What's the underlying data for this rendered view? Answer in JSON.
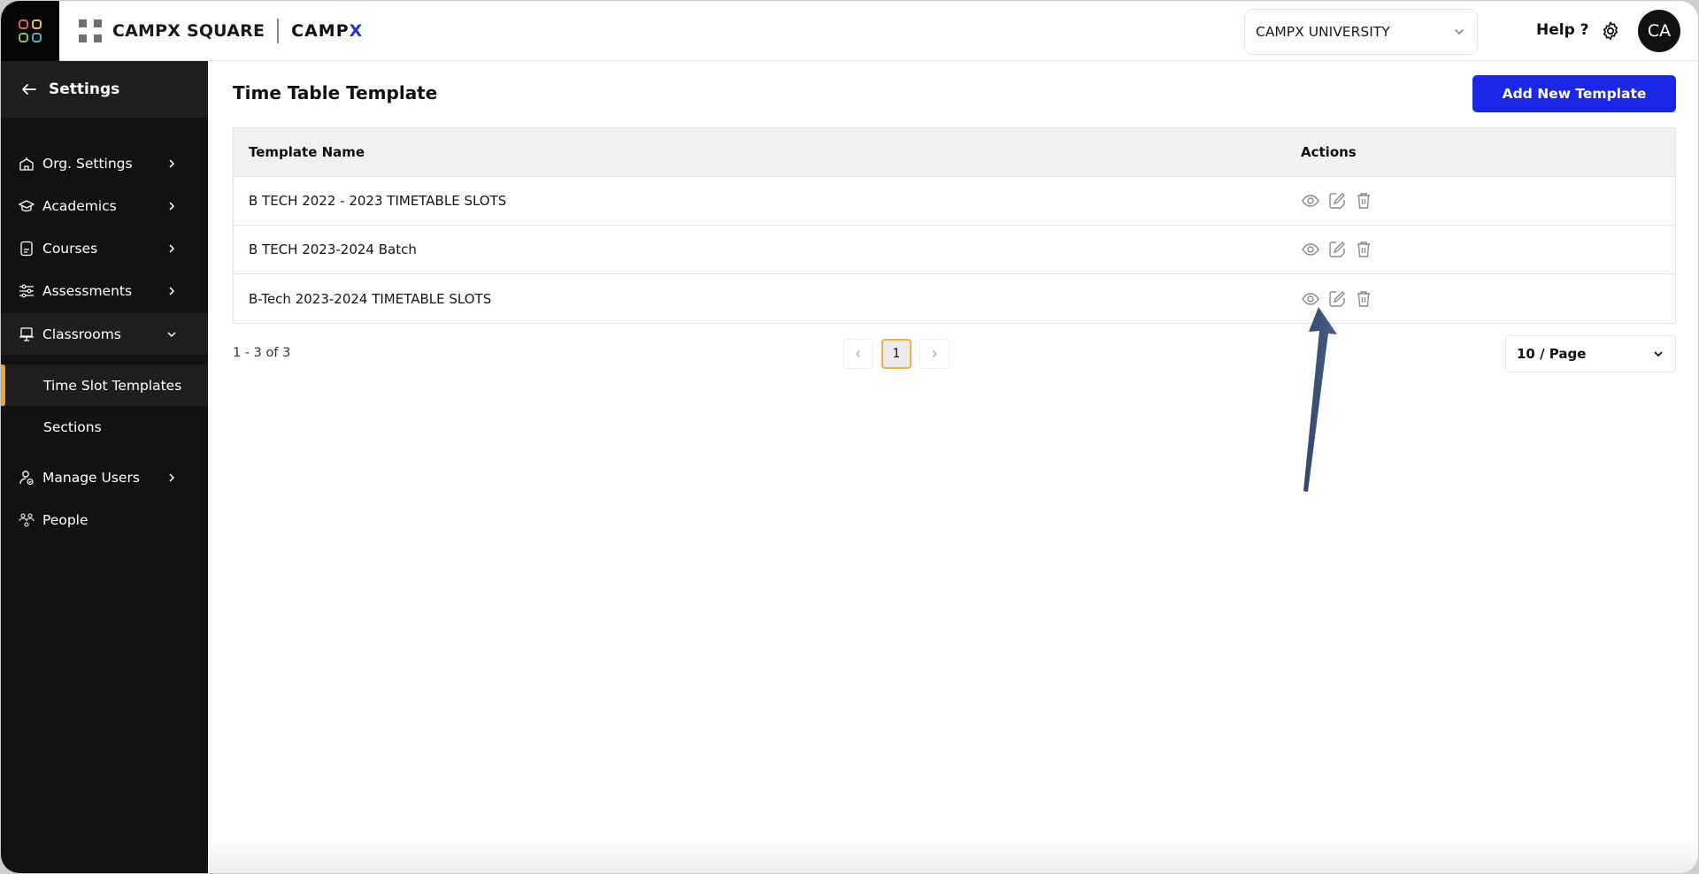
{
  "header": {
    "apps_icon": "apps-grid-icon",
    "apps_colors": [
      "#d9645c",
      "#e3c45a",
      "#8fbf6a",
      "#5fa9cf"
    ],
    "brand_primary": "CAMPX SQUARE",
    "brand_secondary_main": "CAMP",
    "brand_secondary_accent": "X",
    "brand_accent_color": "#2236c9",
    "org_select": {
      "value": "CAMPX UNIVERSITY"
    },
    "help_label": "Help ?",
    "settings_icon": "gear-icon",
    "avatar_initials": "CA"
  },
  "sidebar": {
    "title": "Settings",
    "items": [
      {
        "label": "Org. Settings",
        "icon": "building-icon",
        "expandable": true,
        "expanded": false
      },
      {
        "label": "Academics",
        "icon": "graduation-cap-icon",
        "expandable": true,
        "expanded": false
      },
      {
        "label": "Courses",
        "icon": "document-icon",
        "expandable": true,
        "expanded": false
      },
      {
        "label": "Assessments",
        "icon": "sliders-icon",
        "expandable": true,
        "expanded": false
      },
      {
        "label": "Classrooms",
        "icon": "monitor-icon",
        "expandable": true,
        "expanded": true,
        "children": [
          {
            "label": "Time Slot Templates",
            "active": true
          },
          {
            "label": "Sections",
            "active": false
          }
        ]
      },
      {
        "label": "Manage Users",
        "icon": "user-check-icon",
        "expandable": true,
        "expanded": false
      },
      {
        "label": "People",
        "icon": "people-icon",
        "expandable": false
      }
    ],
    "active_accent": "#e3a73b"
  },
  "main": {
    "title": "Time Table Template",
    "add_button_label": "Add New Template",
    "add_button_color": "#1a27e6",
    "table": {
      "columns": [
        "Template Name",
        "Actions"
      ],
      "rows": [
        {
          "name": "B TECH 2022 - 2023 TIMETABLE SLOTS",
          "actions": [
            "view",
            "edit",
            "delete"
          ]
        },
        {
          "name": "B TECH 2023-2024 Batch",
          "actions": [
            "view",
            "edit",
            "delete"
          ]
        },
        {
          "name": "B-Tech 2023-2024 TIMETABLE SLOTS",
          "actions": [
            "view",
            "edit",
            "delete"
          ]
        }
      ]
    },
    "pagination": {
      "summary": "1 - 3 of 3",
      "current_page": "1",
      "page_size": "10 / Page"
    }
  },
  "annotation": {
    "type": "arrow",
    "color": "#3b5278",
    "points_to": "view action, row 3"
  }
}
